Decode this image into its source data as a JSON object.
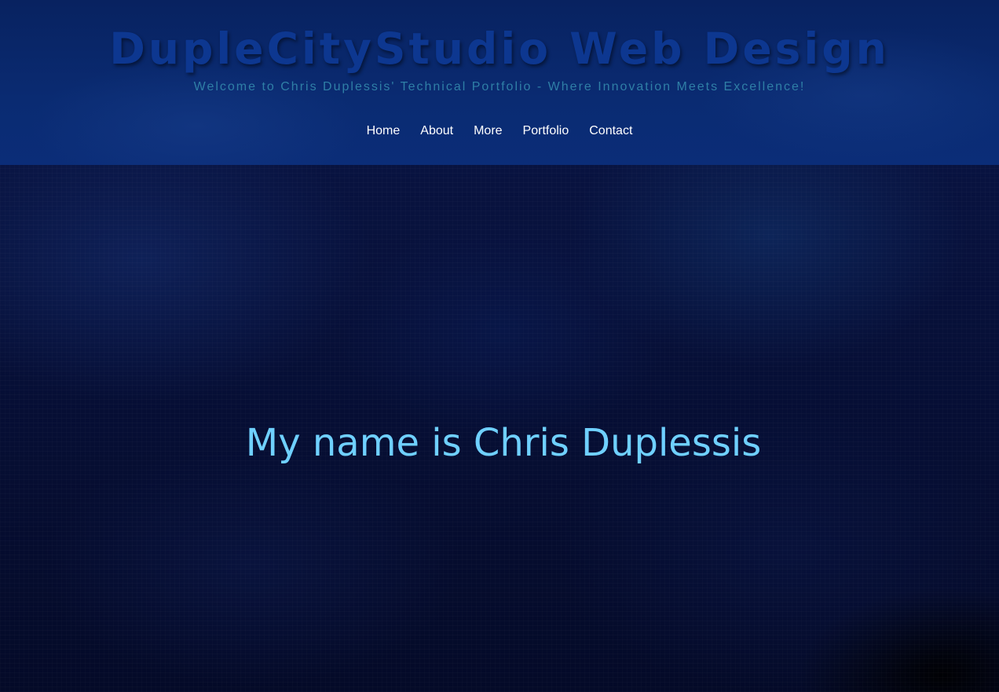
{
  "header": {
    "title": "DupleCityStudio Web Design",
    "tagline": "Welcome to Chris Duplessis' Technical Portfolio - Where Innovation Meets Excellence!"
  },
  "nav": {
    "items": [
      {
        "label": "Home"
      },
      {
        "label": "About"
      },
      {
        "label": "More"
      },
      {
        "label": "Portfolio"
      },
      {
        "label": "Contact"
      }
    ]
  },
  "hero": {
    "heading": "My name is Chris Duplessis"
  },
  "colors": {
    "header_bg": "#0a2b72",
    "title": "#0d3790",
    "tagline": "#2f7fa6",
    "nav_text": "#ffffff",
    "hero_heading": "#6fd0ff",
    "page_bg": "#071039"
  }
}
